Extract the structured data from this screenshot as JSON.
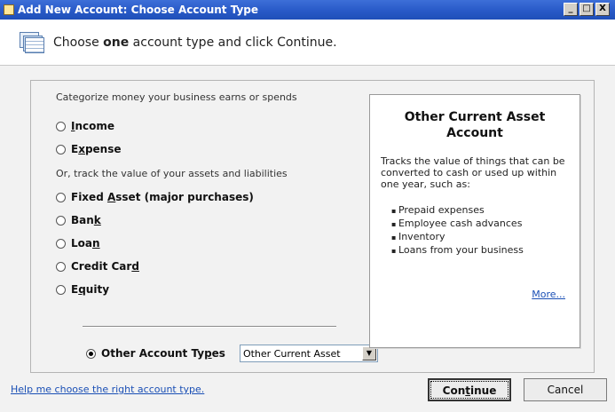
{
  "window": {
    "title": "Add New Account: Choose Account Type",
    "btn_min": "_",
    "btn_max": "□",
    "btn_close": "X"
  },
  "header": {
    "prefix": "Choose ",
    "emphasis": "one",
    "suffix": " account type and click Continue.",
    "icon": "account-sheets-icon"
  },
  "left": {
    "caption1": "Categorize money your business earns or spends",
    "caption2": "Or, track the value of your assets and liabilities",
    "options_group1": [
      {
        "pre": "",
        "ul": "I",
        "post": "ncome"
      },
      {
        "pre": "E",
        "ul": "x",
        "post": "pense"
      }
    ],
    "options_group2": [
      {
        "pre": "Fixed ",
        "ul": "A",
        "post": "sset (major purchases)"
      },
      {
        "pre": "Ban",
        "ul": "k",
        "post": ""
      },
      {
        "pre": "Loa",
        "ul": "n",
        "post": ""
      },
      {
        "pre": "Credit Car",
        "ul": "d",
        "post": ""
      },
      {
        "pre": "E",
        "ul": "q",
        "post": "uity"
      }
    ],
    "other": {
      "pre": "Other Account Ty",
      "ul": "p",
      "post": "es"
    },
    "selected_type": "Other Current Asset"
  },
  "info": {
    "title": "Other Current Asset Account",
    "description": "Tracks the value of things that can be converted to cash or used up within one year, such as:",
    "items": [
      "Prepaid expenses",
      "Employee cash advances",
      "Inventory",
      "Loans from your business"
    ],
    "more": "More..."
  },
  "footer": {
    "help": "Help me choose the right account type.",
    "continue_pre": "Con",
    "continue_ul": "t",
    "continue_post": "inue",
    "cancel": "Cancel"
  }
}
